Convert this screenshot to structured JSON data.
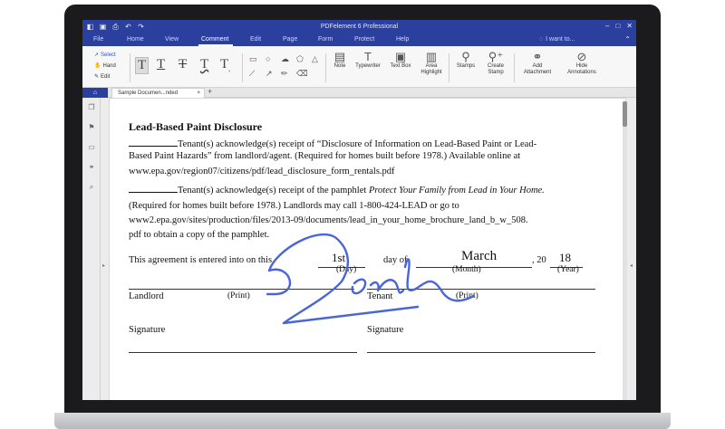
{
  "window": {
    "title": "PDFelement 6 Professional",
    "quick_access": [
      "app-logo-icon",
      "save-icon",
      "print-icon",
      "undo-icon",
      "redo-icon"
    ]
  },
  "menu": {
    "items": [
      "File",
      "Home",
      "View",
      "Comment",
      "Edit",
      "Page",
      "Form",
      "Protect",
      "Help"
    ],
    "active": "Comment",
    "search_placeholder": "I want to..."
  },
  "ribbon": {
    "modes": [
      "Select",
      "Hand",
      "Edit"
    ],
    "tools": {
      "note": "Note",
      "typewriter": "Typewriter",
      "text_box": "Text Box",
      "area_highlight": [
        "Area",
        "Highlight"
      ],
      "stamps": "Stamps",
      "create_stamp": [
        "Create",
        "Stamp"
      ],
      "add_attachment": [
        "Add",
        "Attachment"
      ],
      "hide_annotations": [
        "Hide",
        "Annotations"
      ]
    }
  },
  "tabs": {
    "document": "Sample Documen...nded",
    "close": "×",
    "add": "+"
  },
  "document": {
    "title": "Lead-Based Paint Disclosure",
    "p1": [
      "Tenant(s) acknowledge(s) receipt of “Disclosure of Information on Lead-Based Paint or Lead-",
      "Based Paint Hazards” from landlord/agent. (Required for homes built before 1978.) Available online at",
      "www.epa.gov/region07/citizens/pdf/lead_disclosure_form_rentals.pdf"
    ],
    "p2": {
      "lead": "Tenant(s) acknowledge(s) receipt of the pamphlet ",
      "italic": "Protect Your Family from Lead in Your Home.",
      "lines": [
        "(Required for homes built before 1978.) Landlords may call 1-800-424-LEAD or go to",
        "www2.epa.gov/sites/production/files/2013-09/documents/lead_in_your_home_brochure_land_b_w_508.",
        "pdf to obtain a copy of the pamphlet."
      ]
    },
    "agreement": {
      "lead": "This agreement is entered into on this",
      "day_value": "1st",
      "day_label": "(Day)",
      "day_of": "day of",
      "month_value": "March",
      "month_label": "(Month)",
      "year_prefix": ", 20",
      "year_value": "18",
      "year_label": "(Year)"
    },
    "landlord": "Landlord",
    "print_1": "(Print)",
    "tenant": "Tenant",
    "print_2": "(Print)",
    "signature_1": "Signature",
    "signature_2": "Signature",
    "signature_color": "#4a66d6"
  },
  "colors": {
    "titlebar": "#2b3f9e",
    "accent": "#2b58d8"
  }
}
